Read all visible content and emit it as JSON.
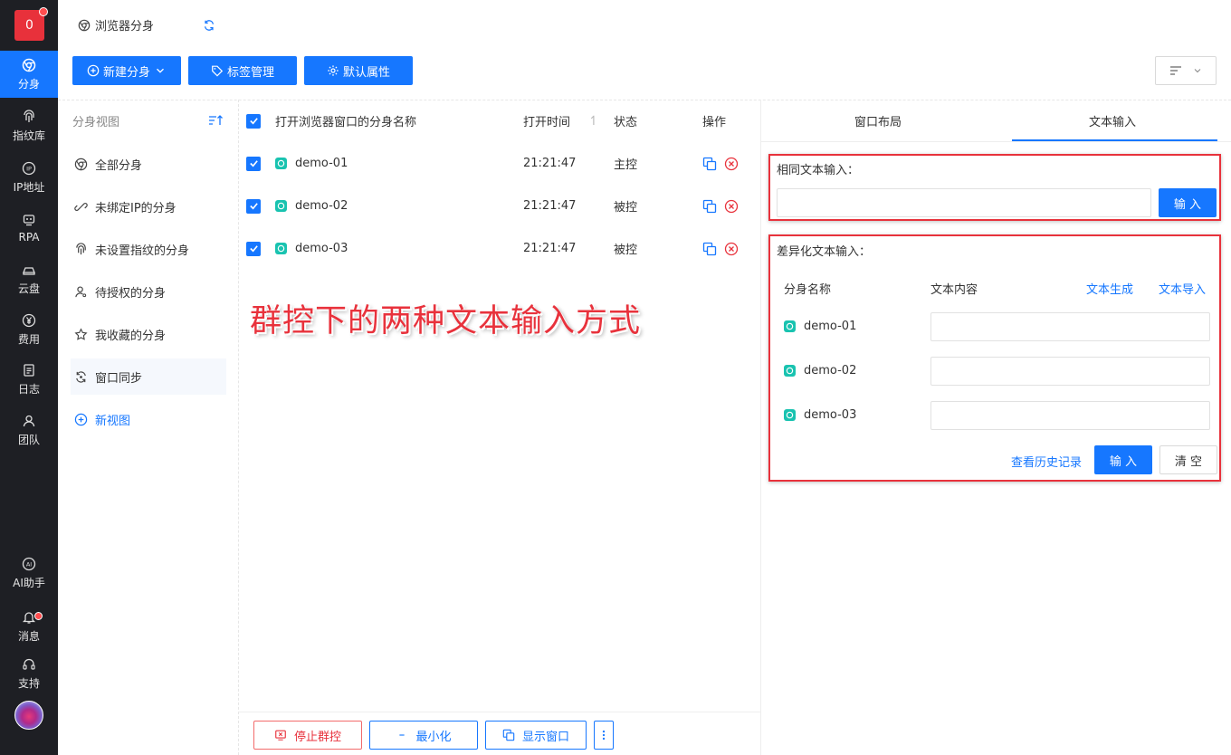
{
  "app": {
    "logo_text": "0"
  },
  "rail": [
    {
      "label": "分身",
      "icon": "chrome-icon"
    },
    {
      "label": "指纹库",
      "icon": "fingerprint-icon"
    },
    {
      "label": "IP地址",
      "icon": "ip-icon"
    },
    {
      "label": "RPA",
      "icon": "robot-icon"
    },
    {
      "label": "云盘",
      "icon": "cloud-drive-icon"
    },
    {
      "label": "费用",
      "icon": "yen-icon"
    },
    {
      "label": "日志",
      "icon": "log-icon"
    },
    {
      "label": "团队",
      "icon": "team-icon"
    },
    {
      "label": "AI助手",
      "icon": "ai-icon"
    },
    {
      "label": "消息",
      "icon": "bell-icon"
    },
    {
      "label": "支持",
      "icon": "headset-icon"
    }
  ],
  "header": {
    "title": "浏览器分身"
  },
  "toolbar": {
    "new_label": "新建分身",
    "tags_label": "标签管理",
    "defaults_label": "默认属性"
  },
  "views": {
    "heading": "分身视图",
    "items": [
      "全部分身",
      "未绑定IP的分身",
      "未设置指纹的分身",
      "待授权的分身",
      "我收藏的分身",
      "窗口同步"
    ],
    "new_view": "新视图"
  },
  "table": {
    "headers": {
      "name": "打开浏览器窗口的分身名称",
      "time": "打开时间",
      "status": "状态",
      "ops": "操作"
    },
    "rows": [
      {
        "name": "demo-01",
        "time": "21:21:47",
        "status": "主控"
      },
      {
        "name": "demo-02",
        "time": "21:21:47",
        "status": "被控"
      },
      {
        "name": "demo-03",
        "time": "21:21:47",
        "status": "被控"
      }
    ]
  },
  "overlay_text": "群控下的两种文本输入方式",
  "bottom": {
    "stop_label": "停止群控",
    "minimize_label": "最小化",
    "show_label": "显示窗口"
  },
  "panel": {
    "tabs": [
      "窗口布局",
      "文本输入"
    ],
    "same": {
      "title": "相同文本输入：",
      "input_value": "",
      "submit_label": "输 入"
    },
    "diff": {
      "title": "差异化文本输入：",
      "col_name": "分身名称",
      "col_content": "文本内容",
      "generate_label": "文本生成",
      "import_label": "文本导入",
      "rows": [
        {
          "name": "demo-01",
          "value": ""
        },
        {
          "name": "demo-02",
          "value": ""
        },
        {
          "name": "demo-03",
          "value": ""
        }
      ],
      "history_label": "查看历史记录",
      "submit_label": "输 入",
      "clear_label": "清 空"
    }
  },
  "colors": {
    "primary": "#1677ff",
    "danger": "#e8323c",
    "rail_bg": "#1e1f24"
  }
}
